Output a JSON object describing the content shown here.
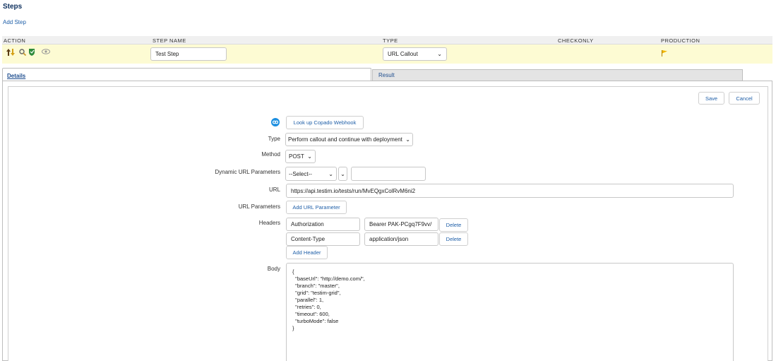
{
  "section": {
    "title": "Steps",
    "add_step": "Add Step"
  },
  "table": {
    "headers": [
      "ACTION",
      "STEP NAME",
      "TYPE",
      "CHECKONLY",
      "PRODUCTION"
    ],
    "row": {
      "step_name": "Test Step",
      "type_value": "URL Callout",
      "action_icons": [
        "reorder-icon",
        "search-icon",
        "edit-shield-icon",
        "view-icon"
      ],
      "production_icon": "flag-icon"
    }
  },
  "tabs": {
    "details": "Details",
    "result": "Result"
  },
  "actions": {
    "save": "Save",
    "cancel": "Cancel"
  },
  "form": {
    "lookup_button": "Look up Copado Webhook",
    "type_label": "Type",
    "type_value": "Perform callout and continue with deployment",
    "method_label": "Method",
    "method_value": "POST",
    "dyn_label": "Dynamic URL Parameters",
    "dyn_select": "--Select--",
    "dyn_input": "",
    "url_label": "URL",
    "url_value": "https://api.testim.io/tests/run/MvEQgxColRvM6ni2",
    "url_params_label": "URL Parameters",
    "add_url_param": "Add URL Parameter",
    "headers_label": "Headers",
    "headers": [
      {
        "key": "Authorization",
        "value": "Bearer PAK-PCgq7F9vv/",
        "delete": "Delete"
      },
      {
        "key": "Content-Type",
        "value": "application/json",
        "delete": "Delete"
      }
    ],
    "add_header": "Add Header",
    "body_label": "Body",
    "body_value": "{\n  \"baseUrl\": \"http://demo.com/\",\n  \"branch\": \"master\",\n  \"grid\": \"testim-grid\",\n  \"parallel\": 1,\n  \"retries\": 0,\n  \"timeout\": 600,\n  \"turboMode\": false\n}"
  },
  "colors": {
    "link": "#1f5fa8",
    "row_highlight": "#fdfbd3",
    "title": "#0b2e5c"
  }
}
